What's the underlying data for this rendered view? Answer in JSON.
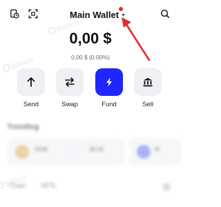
{
  "header": {
    "wallet_name": "Main Wallet",
    "caret": "▼",
    "icons": [
      "history-icon",
      "scan-icon",
      "search-icon"
    ],
    "notification_color": "#e32b2b"
  },
  "balance": {
    "amount": "0,00 $",
    "sub": "0,00 $ (0.00%)"
  },
  "actions": [
    {
      "label": "Send",
      "icon": "arrow-up-icon"
    },
    {
      "label": "Swap",
      "icon": "swap-icon"
    },
    {
      "label": "Fund",
      "icon": "lightning-icon"
    },
    {
      "label": "Sell",
      "icon": "bank-icon"
    }
  ],
  "colors": {
    "accent": "#1f26ff",
    "button_bg": "#eef0f3",
    "annotation_arrow": "#e32b2b"
  },
  "trending": {
    "title": "Trending",
    "cards": [
      {
        "name": "ЅНІВ",
        "value": "$0,00"
      },
      {
        "name": "W"
      }
    ]
  },
  "tabs": [
    "Chain",
    "NFTs"
  ],
  "watermark": "Bitlich"
}
